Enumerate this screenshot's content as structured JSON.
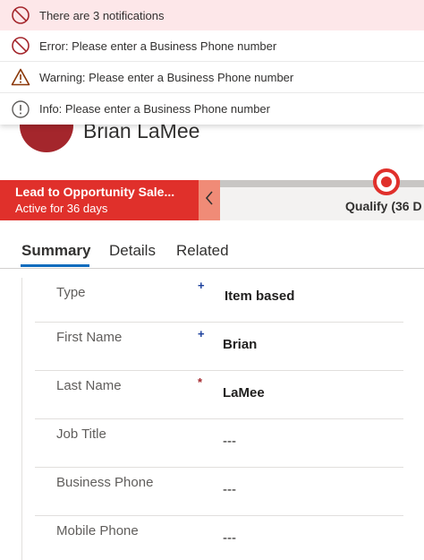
{
  "notifications": {
    "summary": "There are 3 notifications",
    "items": [
      {
        "type": "error",
        "text": "Error: Please enter a Business Phone number"
      },
      {
        "type": "warning",
        "text": "Warning: Please enter a Business Phone number"
      },
      {
        "type": "info",
        "text": "Info: Please enter a Business Phone number"
      }
    ],
    "icons": [
      "blocked-icon",
      "warning-triangle-icon",
      "info-icon"
    ]
  },
  "header": {
    "record_name": "Brian LaMee"
  },
  "bpf": {
    "process_name": "Lead to Opportunity Sale...",
    "active_for": "Active for 36 days",
    "stage_label": "Qualify  (36 D",
    "collapse_icon": "chevron-left-icon",
    "accent_color": "#e0302b"
  },
  "tabs": [
    {
      "label": "Summary",
      "active": true
    },
    {
      "label": "Details",
      "active": false
    },
    {
      "label": "Related",
      "active": false
    }
  ],
  "form": {
    "fields": [
      {
        "label": "Type",
        "required_marker": "+",
        "value": "Item based"
      },
      {
        "label": "First Name",
        "required_marker": "+",
        "value": "Brian"
      },
      {
        "label": "Last Name",
        "required_marker": "*",
        "value": "LaMee"
      },
      {
        "label": "Job Title",
        "required_marker": "",
        "value": "---"
      },
      {
        "label": "Business Phone",
        "required_marker": "",
        "value": "---"
      },
      {
        "label": "Mobile Phone",
        "required_marker": "",
        "value": "---"
      }
    ]
  }
}
